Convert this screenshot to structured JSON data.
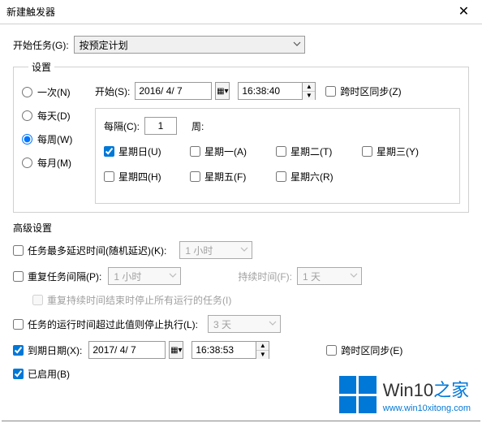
{
  "window": {
    "title": "新建触发器",
    "close": "✕"
  },
  "begin_task": {
    "label": "开始任务(G):",
    "value": "按预定计划"
  },
  "settings": {
    "legend": "设置",
    "radios": {
      "once": "一次(N)",
      "daily": "每天(D)",
      "weekly": "每周(W)",
      "monthly": "每月(M)"
    },
    "start": {
      "label": "开始(S):",
      "date": "2016/ 4/ 7",
      "time": "16:38:40",
      "sync": "跨时区同步(Z)"
    },
    "interval": {
      "label": "每隔(C):",
      "value": "1",
      "unit": "周:"
    },
    "days": {
      "sun": "星期日(U)",
      "mon": "星期一(A)",
      "tue": "星期二(T)",
      "wed": "星期三(Y)",
      "thu": "星期四(H)",
      "fri": "星期五(F)",
      "sat": "星期六(R)"
    }
  },
  "advanced": {
    "title": "高级设置",
    "delay": {
      "label": "任务最多延迟时间(随机延迟)(K):",
      "value": "1 小时"
    },
    "repeat": {
      "label": "重复任务间隔(P):",
      "value": "1 小时",
      "durLabel": "持续时间(F):",
      "durValue": "1 天"
    },
    "stopAtEnd": {
      "label": "重复持续时间结束时停止所有运行的任务(I)"
    },
    "stopAfter": {
      "label": "任务的运行时间超过此值则停止执行(L):",
      "value": "3 天"
    },
    "expire": {
      "label": "到期日期(X):",
      "date": "2017/ 4/ 7",
      "time": "16:38:53",
      "sync": "跨时区同步(E)"
    },
    "enabled": {
      "label": "已启用(B)"
    }
  },
  "watermark": {
    "brand1": "Win10",
    "brand2": "之家",
    "url": "www.win10xitong.com"
  }
}
